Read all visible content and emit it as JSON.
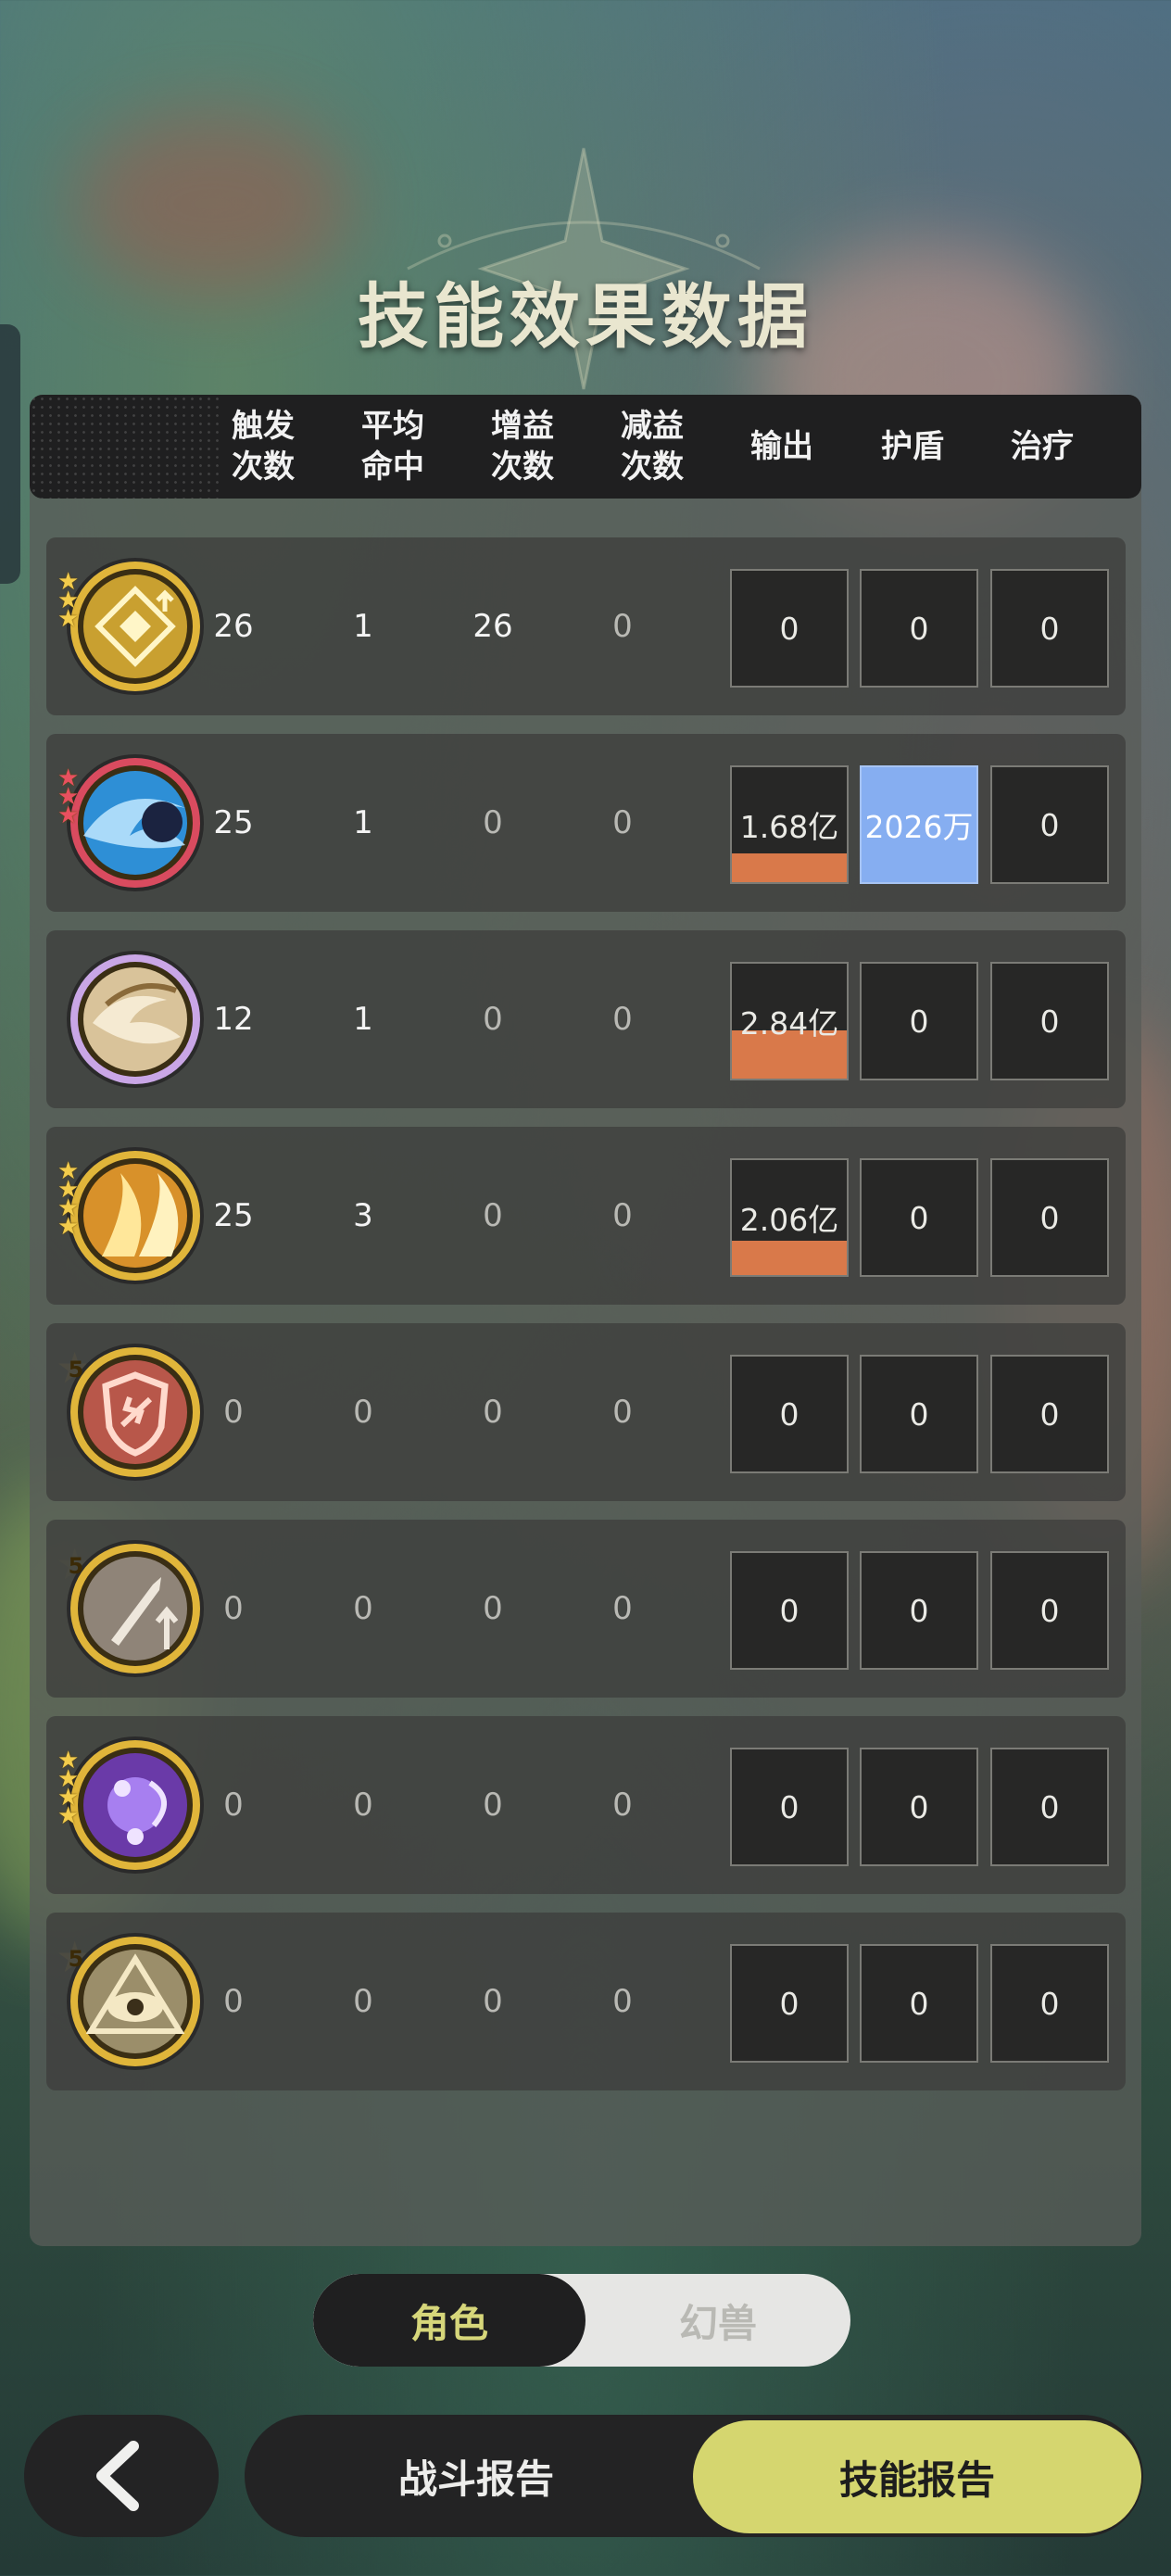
{
  "title": "技能效果数据",
  "columns": [
    "触发\n次数",
    "平均\n命中",
    "增益\n次数",
    "减益\n次数",
    "输出",
    "护盾",
    "治疗"
  ],
  "rows": [
    {
      "icon": "diamond-rune-icon",
      "rank": "3",
      "trigger": "26",
      "avg_hit": "1",
      "buff": "26",
      "debuff": "0",
      "output": "0",
      "output_fill": 0,
      "shield": "0",
      "shield_highlight": false,
      "heal": "0"
    },
    {
      "icon": "water-wave-icon",
      "rank": "3",
      "trigger": "25",
      "avg_hit": "1",
      "buff": "0",
      "debuff": "0",
      "output": "1.68亿",
      "output_fill": 0.25,
      "shield": "2026万",
      "shield_highlight": true,
      "heal": "0"
    },
    {
      "icon": "swirl-wind-icon",
      "rank": "",
      "trigger": "12",
      "avg_hit": "1",
      "buff": "0",
      "debuff": "0",
      "output": "2.84亿",
      "output_fill": 0.42,
      "shield": "0",
      "shield_highlight": false,
      "heal": "0"
    },
    {
      "icon": "golden-slash-icon",
      "rank": "4",
      "trigger": "25",
      "avg_hit": "3",
      "buff": "0",
      "debuff": "0",
      "output": "2.06亿",
      "output_fill": 0.3,
      "shield": "0",
      "shield_highlight": false,
      "heal": "0"
    },
    {
      "icon": "broken-shield-icon",
      "rank": "5",
      "trigger": "0",
      "avg_hit": "0",
      "buff": "0",
      "debuff": "0",
      "output": "0",
      "output_fill": 0,
      "shield": "0",
      "shield_highlight": false,
      "heal": "0"
    },
    {
      "icon": "sword-up-icon",
      "rank": "5",
      "trigger": "0",
      "avg_hit": "0",
      "buff": "0",
      "debuff": "0",
      "output": "0",
      "output_fill": 0,
      "shield": "0",
      "shield_highlight": false,
      "heal": "0"
    },
    {
      "icon": "purple-spirit-icon",
      "rank": "4",
      "trigger": "0",
      "avg_hit": "0",
      "buff": "0",
      "debuff": "0",
      "output": "0",
      "output_fill": 0,
      "shield": "0",
      "shield_highlight": false,
      "heal": "0"
    },
    {
      "icon": "eye-pyramid-icon",
      "rank": "5",
      "trigger": "0",
      "avg_hit": "0",
      "buff": "0",
      "debuff": "0",
      "output": "0",
      "output_fill": 0,
      "shield": "0",
      "shield_highlight": false,
      "heal": "0"
    }
  ],
  "toggle": {
    "active": "角色",
    "inactive": "幻兽"
  },
  "nav": {
    "back": "back-arrow-icon",
    "battle_report": "战斗报告",
    "skill_report": "技能报告"
  },
  "colors": {
    "accent": "#d5d66f",
    "output_bar": "#d9794a",
    "shield_highlight": "#86aef1"
  }
}
